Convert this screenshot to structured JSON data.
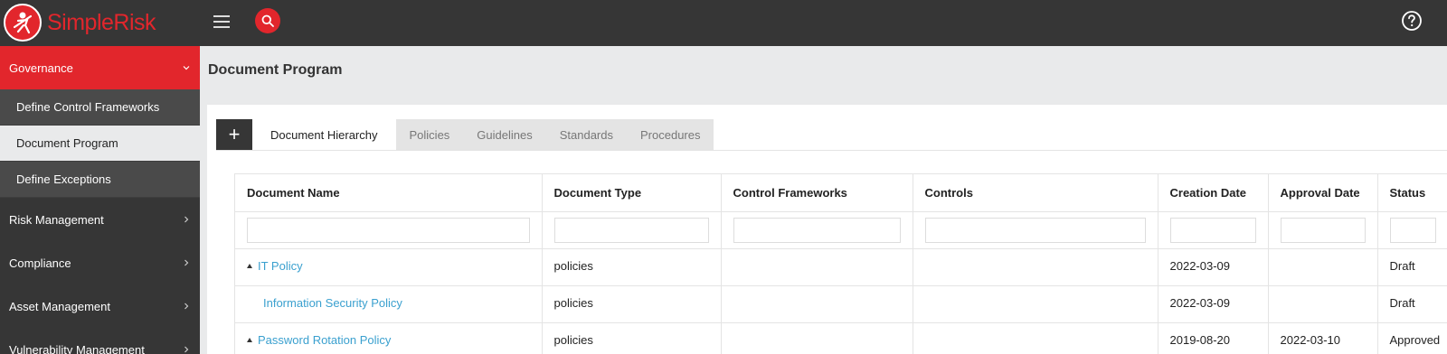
{
  "brand": {
    "name": "SimpleRisk",
    "accent": "#e2262c"
  },
  "colors": {
    "topbar": "#363636",
    "link": "#3aa0cf"
  },
  "sidebar": {
    "items": [
      {
        "label": "Governance",
        "active": true,
        "expanded": true
      },
      {
        "label": "Risk Management"
      },
      {
        "label": "Compliance"
      },
      {
        "label": "Asset Management"
      },
      {
        "label": "Vulnerability Management"
      }
    ],
    "governance_subitems": [
      {
        "label": "Define Control Frameworks"
      },
      {
        "label": "Document Program",
        "active": true
      },
      {
        "label": "Define Exceptions"
      }
    ]
  },
  "page": {
    "title": "Document Program"
  },
  "tabs": {
    "add_label": "+",
    "items": [
      {
        "label": "Document Hierarchy",
        "active": true
      },
      {
        "label": "Policies"
      },
      {
        "label": "Guidelines"
      },
      {
        "label": "Standards"
      },
      {
        "label": "Procedures"
      }
    ]
  },
  "table": {
    "columns": [
      "Document Name",
      "Document Type",
      "Control Frameworks",
      "Controls",
      "Creation Date",
      "Approval Date",
      "Status"
    ],
    "rows": [
      {
        "name": "IT Policy",
        "type": "policies",
        "frameworks": "",
        "controls": "",
        "created": "2022-03-09",
        "approved": "",
        "status": "Draft",
        "expandable": true,
        "level": 0
      },
      {
        "name": "Information Security Policy",
        "type": "policies",
        "frameworks": "",
        "controls": "",
        "created": "2022-03-09",
        "approved": "",
        "status": "Draft",
        "expandable": false,
        "level": 1
      },
      {
        "name": "Password Rotation Policy",
        "type": "policies",
        "frameworks": "",
        "controls": "",
        "created": "2019-08-20",
        "approved": "2022-03-10",
        "status": "Approved",
        "expandable": true,
        "level": 0
      }
    ]
  },
  "icons": [
    "simplerisk-logo-icon",
    "hamburger-menu-icon",
    "search-icon",
    "help-icon",
    "chevron-down-icon",
    "chevron-right-icon",
    "expand-triangle-icon"
  ]
}
